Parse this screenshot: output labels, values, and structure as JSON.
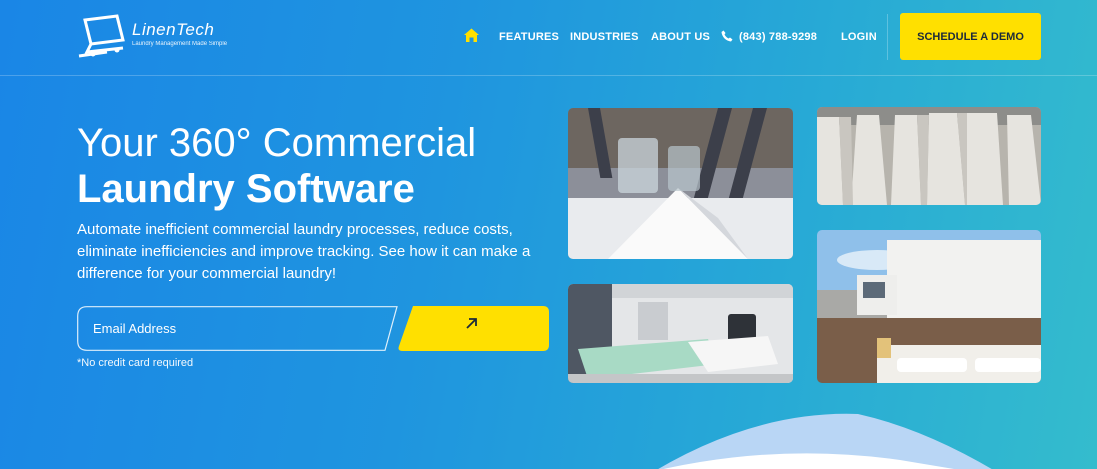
{
  "header": {
    "logo": {
      "name": "LinenTech",
      "tagline": "Laundry Management Made Simple"
    },
    "nav": {
      "home_icon": "home-icon",
      "features": "FEATURES",
      "industries": "INDUSTRIES",
      "about": "ABOUT US",
      "phone_icon": "phone-icon",
      "phone": "(843) 788-9298",
      "login": "LOGIN"
    },
    "cta_label": "SCHEDULE A DEMO"
  },
  "hero": {
    "title_line1": "Your 360° Commercial",
    "title_line2": "Laundry Software",
    "lead": "Automate inefficient commercial laundry processes, reduce costs, eliminate inefficiencies and improve tracking. See how it can make a difference for your commercial laundry!",
    "email_placeholder": "Email Address",
    "submit_icon": "arrow-up-right-icon",
    "note": "*No credit card required"
  },
  "colors": {
    "accent_yellow": "#ffe000",
    "bg_start": "#1a86e6",
    "bg_end": "#34bccd",
    "button_text": "#1c2a3a"
  }
}
